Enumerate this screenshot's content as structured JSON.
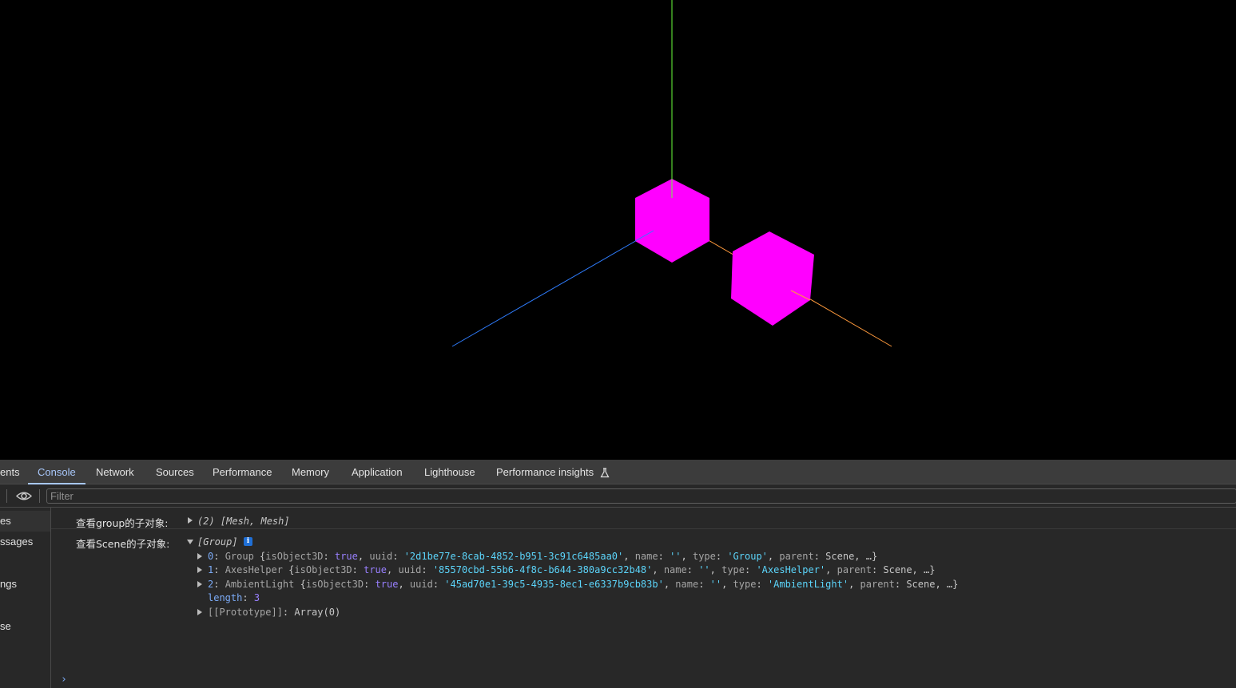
{
  "scene": {
    "colors": {
      "background": "#000000",
      "cube": "#ff00ff",
      "axis_x": "#ff9a3c",
      "axis_y": "#6aff3c",
      "axis_z": "#2f7dff"
    }
  },
  "devtools": {
    "tabs": [
      {
        "label": "ents",
        "active": false
      },
      {
        "label": "Console",
        "active": true
      },
      {
        "label": "Network",
        "active": false
      },
      {
        "label": "Sources",
        "active": false
      },
      {
        "label": "Performance",
        "active": false
      },
      {
        "label": "Memory",
        "active": false
      },
      {
        "label": "Application",
        "active": false
      },
      {
        "label": "Lighthouse",
        "active": false
      },
      {
        "label": "Performance insights",
        "active": false
      }
    ],
    "filter_placeholder": "Filter",
    "sidebar": [
      "es",
      "ssages",
      "ngs",
      "se"
    ],
    "console": {
      "msg1": {
        "label": "查看group的子对象:",
        "summary": "(2) [Mesh, Mesh]"
      },
      "msg2": {
        "label": "查看Scene的子对象:",
        "summary": "[Group]",
        "info_badge": "i",
        "items": [
          {
            "index": "0",
            "type_name": "Group",
            "is3d": "true",
            "uuid": "'2d1be77e-8cab-4852-b951-3c91c6485aa0'",
            "type": "'Group'",
            "parent": "Scene"
          },
          {
            "index": "1",
            "type_name": "AxesHelper",
            "is3d": "true",
            "uuid": "'85570cbd-55b6-4f8c-b644-380a9cc32b48'",
            "type": "'AxesHelper'",
            "parent": "Scene"
          },
          {
            "index": "2",
            "type_name": "AmbientLight",
            "is3d": "true",
            "uuid": "'45ad70e1-39c5-4935-8ec1-e6337b9cb83b'",
            "type": "'AmbientLight'",
            "parent": "Scene"
          }
        ],
        "length_key": "length",
        "length_value": "3",
        "prototype_key": "[[Prototype]]",
        "prototype_value": "Array(0)"
      },
      "prompt": "›"
    }
  }
}
